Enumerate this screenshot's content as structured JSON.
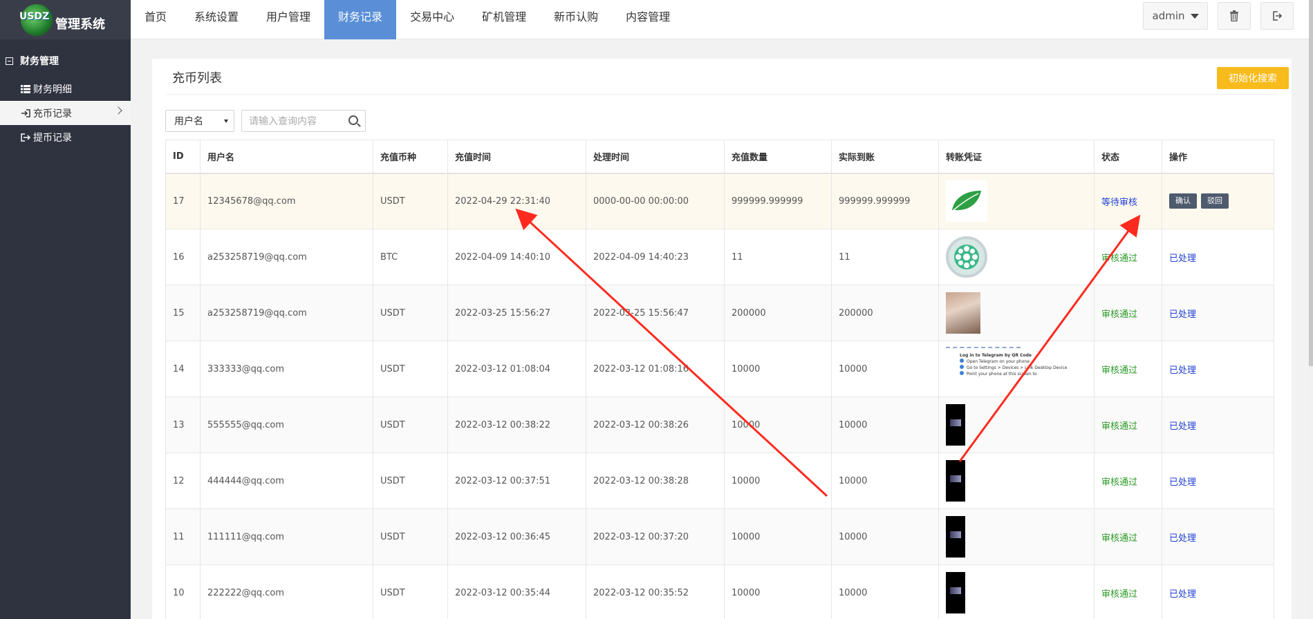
{
  "app": {
    "logo_badge": "USDZ",
    "logo_title": "管理系统"
  },
  "topnav": {
    "items": [
      "首页",
      "系统设置",
      "用户管理",
      "财务记录",
      "交易中心",
      "矿机管理",
      "新币认购",
      "内容管理"
    ],
    "active": "财务记录",
    "user": "admin"
  },
  "sidebar": {
    "group": "财务管理",
    "items": [
      {
        "label": "财务明细",
        "icon": "list-icon"
      },
      {
        "label": "充币记录",
        "icon": "sign-in-icon",
        "active": true
      },
      {
        "label": "提币记录",
        "icon": "sign-out-icon"
      }
    ]
  },
  "card": {
    "title": "充币列表",
    "init_search_label": "初始化搜索",
    "filter_select_value": "用户名",
    "search_placeholder": "请输入查询内容"
  },
  "table": {
    "headers": [
      "ID",
      "用户名",
      "充值币种",
      "充值时间",
      "处理时间",
      "充值数量",
      "实际到账",
      "转账凭证",
      "状态",
      "操作"
    ],
    "rows": [
      {
        "id": "17",
        "user": "12345678@qq.com",
        "coin": "USDT",
        "time": "2022-04-29 22:31:40",
        "proc": "0000-00-00 00:00:00",
        "amount": "999999.999999",
        "actual": "999999.999999",
        "voucher": "leaf",
        "status": "等待审核",
        "ops": [
          "确认",
          "驳回"
        ]
      },
      {
        "id": "16",
        "user": "a253258719@qq.com",
        "coin": "BTC",
        "time": "2022-04-09 14:40:10",
        "proc": "2022-04-09 14:40:23",
        "amount": "11",
        "actual": "11",
        "voucher": "circle",
        "status": "审核通过",
        "op_text": "已处理"
      },
      {
        "id": "15",
        "user": "a253258719@qq.com",
        "coin": "USDT",
        "time": "2022-03-25 15:56:27",
        "proc": "2022-03-25 15:56:47",
        "amount": "200000",
        "actual": "200000",
        "voucher": "photo",
        "status": "审核通过",
        "op_text": "已处理"
      },
      {
        "id": "14",
        "user": "333333@qq.com",
        "coin": "USDT",
        "time": "2022-03-12 01:08:04",
        "proc": "2022-03-12 01:08:16",
        "amount": "10000",
        "actual": "10000",
        "voucher": "doc",
        "status": "审核通过",
        "op_text": "已处理"
      },
      {
        "id": "13",
        "user": "555555@qq.com",
        "coin": "USDT",
        "time": "2022-03-12 00:38:22",
        "proc": "2022-03-12 00:38:26",
        "amount": "10000",
        "actual": "10000",
        "voucher": "phone",
        "status": "审核通过",
        "op_text": "已处理"
      },
      {
        "id": "12",
        "user": "444444@qq.com",
        "coin": "USDT",
        "time": "2022-03-12 00:37:51",
        "proc": "2022-03-12 00:38:28",
        "amount": "10000",
        "actual": "10000",
        "voucher": "phone",
        "status": "审核通过",
        "op_text": "已处理"
      },
      {
        "id": "11",
        "user": "111111@qq.com",
        "coin": "USDT",
        "time": "2022-03-12 00:36:45",
        "proc": "2022-03-12 00:37:20",
        "amount": "10000",
        "actual": "10000",
        "voucher": "phone",
        "status": "审核通过",
        "op_text": "已处理"
      },
      {
        "id": "10",
        "user": "222222@qq.com",
        "coin": "USDT",
        "time": "2022-03-12 00:35:44",
        "proc": "2022-03-12 00:35:52",
        "amount": "10000",
        "actual": "10000",
        "voucher": "phone",
        "status": "审核通过",
        "op_text": "已处理"
      }
    ]
  },
  "voucher_doc": {
    "title": "Log in to Telegram by QR Code",
    "lines": [
      "Open Telegram on your phone",
      "Go to Settings > Devices > Link Desktop Device",
      "Point your phone at this screen to"
    ]
  },
  "colors": {
    "sidebar_bg": "#2f3340",
    "logo_bg": "#393d49",
    "nav_active": "#5a8fd8",
    "warn_button": "#f8bb1c",
    "status_pending": "#1e3fd6",
    "status_ok": "#2c9a26",
    "annotation_arrow": "#ff2a1f"
  }
}
